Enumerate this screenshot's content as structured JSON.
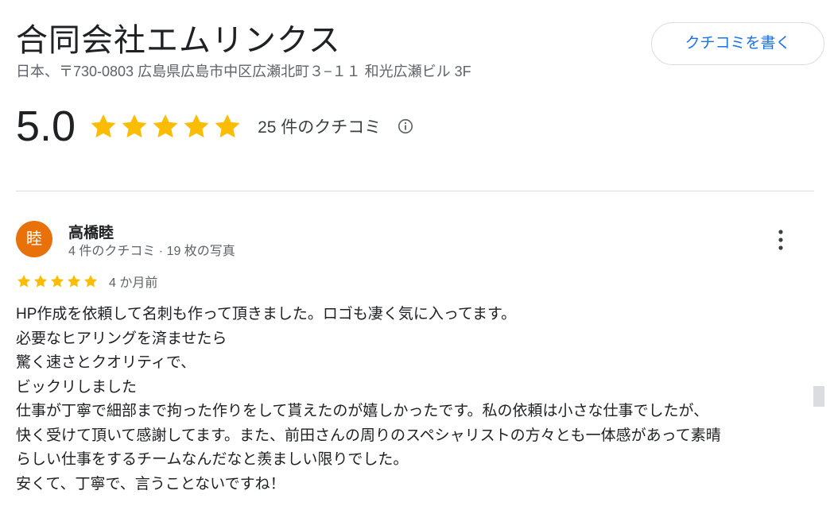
{
  "business": {
    "title": "合同会社エムリンクス",
    "address": "日本、〒730-0803 広島県広島市中区広瀬北町３−１１ 和光広瀬ビル 3F",
    "write_review_label": "クチコミを書く"
  },
  "summary": {
    "rating": "5.0",
    "stars": 5,
    "review_count_label": "25 件のクチコミ",
    "info_icon": "info-icon"
  },
  "review": {
    "avatar_letter": "睦",
    "reviewer_name": "高橋睦",
    "reviewer_meta": "4 件のクチコミ · 19 枚の写真",
    "stars": 5,
    "date": "4 か月前",
    "lines": [
      "HP作成を依頼して名刺も作って頂きました。ロゴも凄く気に入ってます。",
      "必要なヒアリングを済ませたら",
      "驚く速さとクオリティで、",
      "ビックリしました",
      "仕事が丁寧で細部まで拘った作りをして貰えたのが嬉しかったです。私の依頼は小さな仕事でしたが、",
      "快く受けて頂いて感謝してます。また、前田さんの周りのスペシャリストの方々とも一体感があって素晴",
      "らしい仕事をするチームなんだなと羨ましい限りでした。",
      "安くて、丁寧で、言うことないですね！"
    ]
  },
  "colors": {
    "star": "#fbbc04",
    "accent": "#1a73e8",
    "avatar_bg": "#e8710a"
  }
}
